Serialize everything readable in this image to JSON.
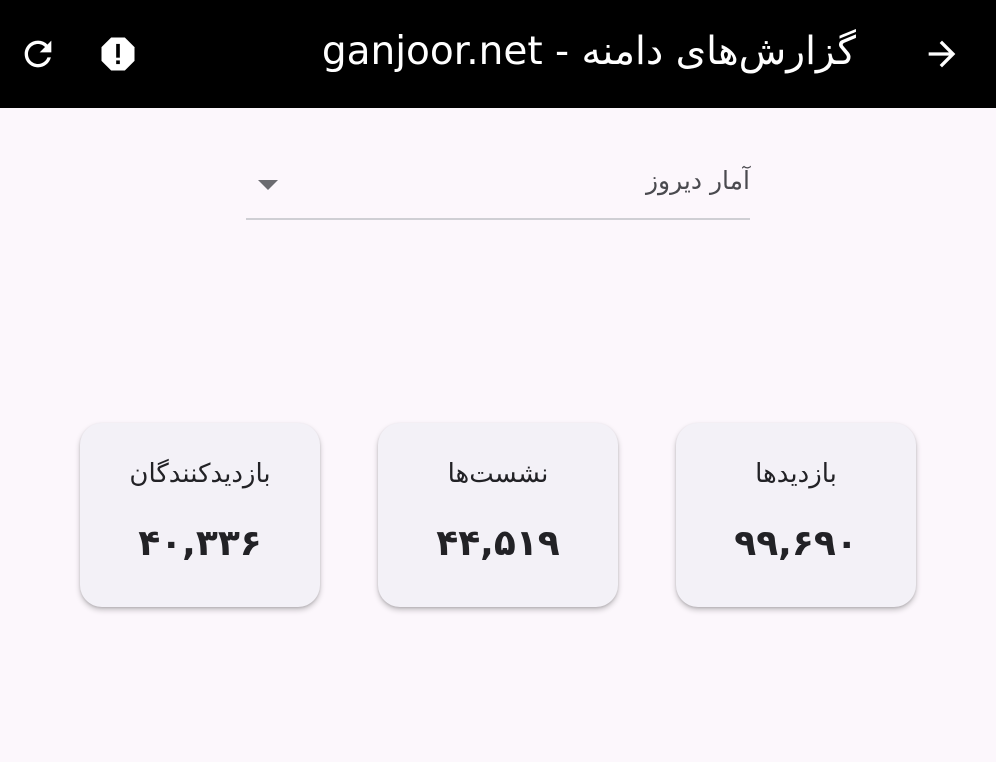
{
  "app_bar": {
    "title": "گزارش‌های دامنه - ganjoor.net",
    "back_icon": "arrow-forward-icon",
    "report_icon": "report-icon",
    "refresh_icon": "refresh-icon",
    "background": "#000000",
    "foreground": "#ffffff"
  },
  "period_select": {
    "selected": "آمار دیروز"
  },
  "stats": {
    "pageviews": {
      "label": "بازدیدها",
      "value": "۹۹,۶۹۰"
    },
    "sessions": {
      "label": "نشست‌ها",
      "value": "۴۴,۵۱۹"
    },
    "visitors": {
      "label": "بازدیدکنندگان",
      "value": "۴۰,۳۳۶"
    }
  },
  "colors": {
    "page_background": "#fcf7fc",
    "card_background": "#f3f1f7",
    "text": "#222226"
  }
}
